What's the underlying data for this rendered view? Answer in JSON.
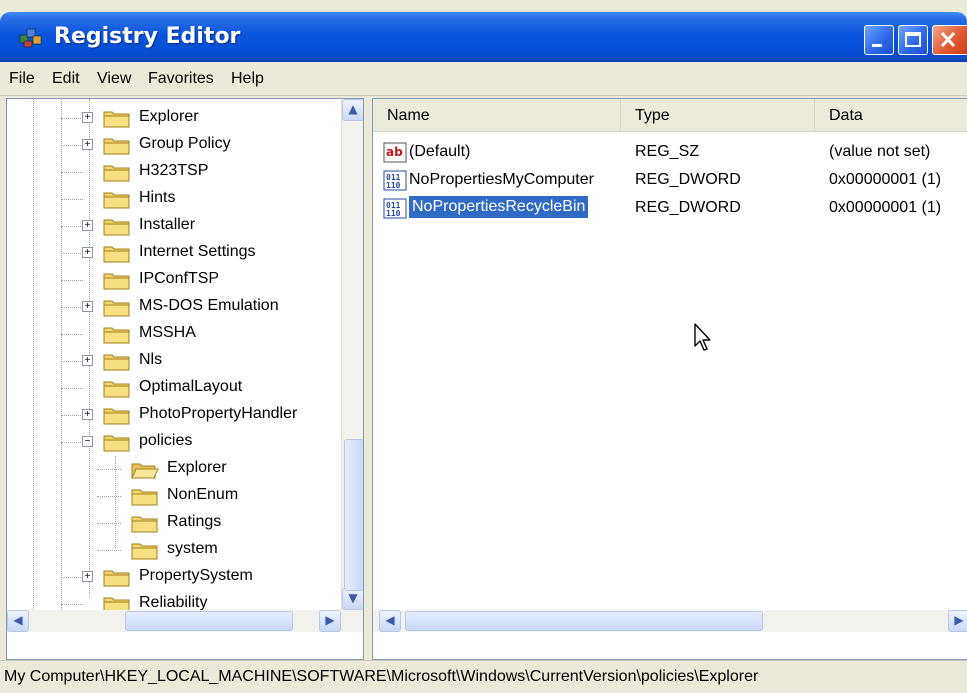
{
  "window": {
    "title": "Registry Editor",
    "colors": {
      "titlebar": "#0a55dc",
      "selection": "#316ac5",
      "chrome": "#ece9d8",
      "close": "#e2572f"
    }
  },
  "menu": [
    "File",
    "Edit",
    "View",
    "Favorites",
    "Help"
  ],
  "tree": {
    "items": [
      {
        "label": "Explorer",
        "expander": "+",
        "level": 0
      },
      {
        "label": "Group Policy",
        "expander": "+",
        "level": 0
      },
      {
        "label": "H323TSP",
        "expander": "",
        "level": 0
      },
      {
        "label": "Hints",
        "expander": "",
        "level": 0
      },
      {
        "label": "Installer",
        "expander": "+",
        "level": 0
      },
      {
        "label": "Internet Settings",
        "expander": "+",
        "level": 0
      },
      {
        "label": "IPConfTSP",
        "expander": "",
        "level": 0
      },
      {
        "label": "MS-DOS Emulation",
        "expander": "+",
        "level": 0
      },
      {
        "label": "MSSHA",
        "expander": "",
        "level": 0
      },
      {
        "label": "Nls",
        "expander": "+",
        "level": 0
      },
      {
        "label": "OptimalLayout",
        "expander": "",
        "level": 0
      },
      {
        "label": "PhotoPropertyHandler",
        "expander": "+",
        "level": 0
      },
      {
        "label": "policies",
        "expander": "−",
        "level": 0
      },
      {
        "label": "Explorer",
        "expander": "",
        "level": 1,
        "open": true
      },
      {
        "label": "NonEnum",
        "expander": "",
        "level": 1
      },
      {
        "label": "Ratings",
        "expander": "",
        "level": 1
      },
      {
        "label": "system",
        "expander": "",
        "level": 1
      },
      {
        "label": "PropertySystem",
        "expander": "+",
        "level": 0
      },
      {
        "label": "Reliability",
        "expander": "",
        "level": 0
      }
    ]
  },
  "list": {
    "columns": [
      "Name",
      "Type",
      "Data"
    ],
    "rows": [
      {
        "name": "(Default)",
        "type": "REG_SZ",
        "data": "(value not set)",
        "icon": "string-value-icon",
        "selected": false
      },
      {
        "name": "NoPropertiesMyComputer",
        "type": "REG_DWORD",
        "data": "0x00000001 (1)",
        "icon": "binary-value-icon",
        "selected": false
      },
      {
        "name": "NoPropertiesRecycleBin",
        "type": "REG_DWORD",
        "data": "0x00000001 (1)",
        "icon": "binary-value-icon",
        "selected": true
      }
    ]
  },
  "statusbar": {
    "path": "My Computer\\HKEY_LOCAL_MACHINE\\SOFTWARE\\Microsoft\\Windows\\CurrentVersion\\policies\\Explorer"
  }
}
